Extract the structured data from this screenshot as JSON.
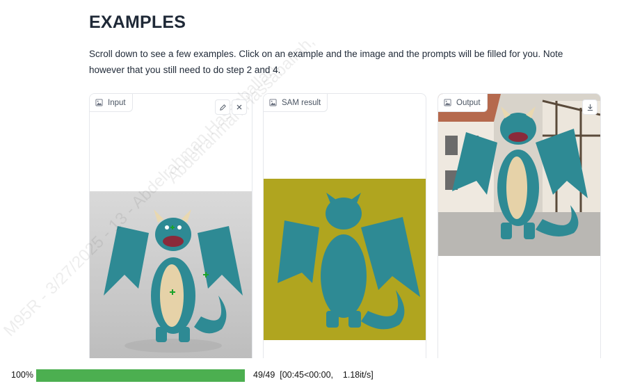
{
  "section": {
    "title": "EXAMPLES",
    "description": "Scroll down to see a few examples. Click on an example and the image and the prompts will be filled for you. Note however that you still need to do step 2 and 4."
  },
  "panels": {
    "input": {
      "label": "Input",
      "icon": "image-icon",
      "edit_icon": "pencil-icon",
      "close_icon": "close-icon"
    },
    "sam": {
      "label": "SAM result",
      "icon": "image-icon"
    },
    "output": {
      "label": "Output",
      "icon": "image-icon",
      "download_icon": "download-icon"
    }
  },
  "progress": {
    "percent_label": "100%",
    "fraction": 1.0,
    "stats": "49/49  [00:45<00:00,    1.18it/s]"
  },
  "watermark": {
    "text_a": "Abdelrahman Hassaballah,",
    "text_b": "M95R - 3/27/2025 - 13 - Abdelrahman Hassaballah,"
  },
  "colors": {
    "progress_fill": "#4caf50",
    "sam_background": "#b0a51f",
    "dragon": "#2e8a94"
  }
}
